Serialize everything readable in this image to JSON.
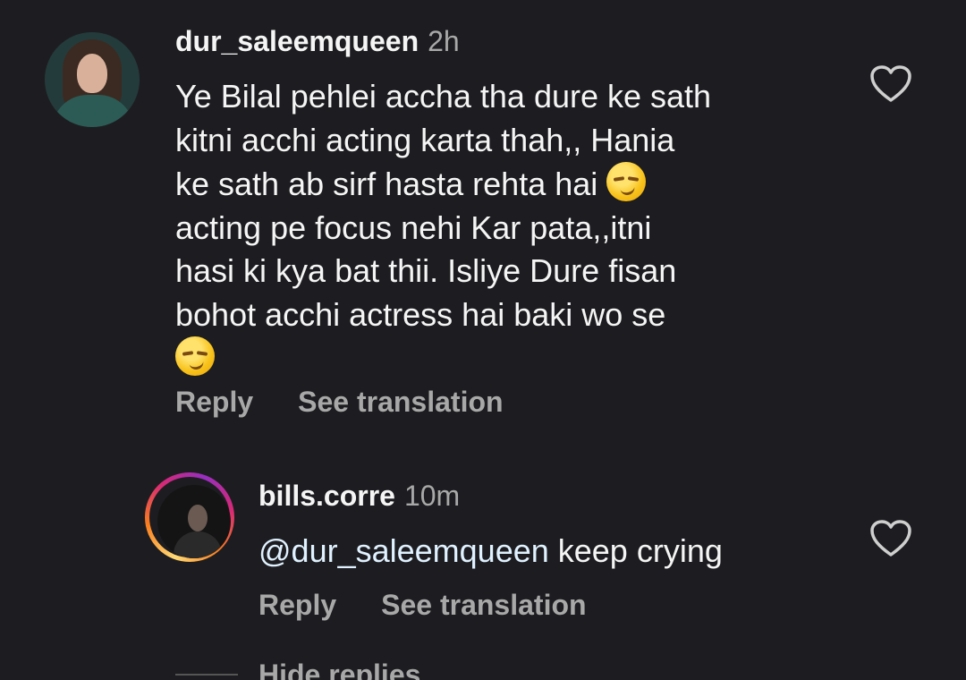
{
  "comments": [
    {
      "username": "dur_saleemqueen",
      "time": "2h",
      "lines": [
        "Ye Bilal pehlei accha tha dure ke sath",
        "kitni acchi acting karta thah,, Hania",
        "ke sath ab sirf hasta rehta hai",
        "acting pe focus nehi Kar pata,,itni",
        "hasi ki kya bat thii. Isliye Dure fisan",
        "bohot acchi actress hai baki wo se"
      ],
      "emoji": "smirking-face",
      "actions": {
        "reply": "Reply",
        "translate": "See translation"
      }
    },
    {
      "username": "bills.corre",
      "time": "10m",
      "mention": "@dur_saleemqueen",
      "text": " keep crying",
      "actions": {
        "reply": "Reply",
        "translate": "See translation"
      }
    }
  ],
  "hide_replies": "Hide replies",
  "icons": {
    "like": "heart-outline-icon"
  },
  "colors": {
    "background": "#1d1d21",
    "primary_text": "#f5f5f5",
    "secondary_text": "#a8a8a8"
  }
}
